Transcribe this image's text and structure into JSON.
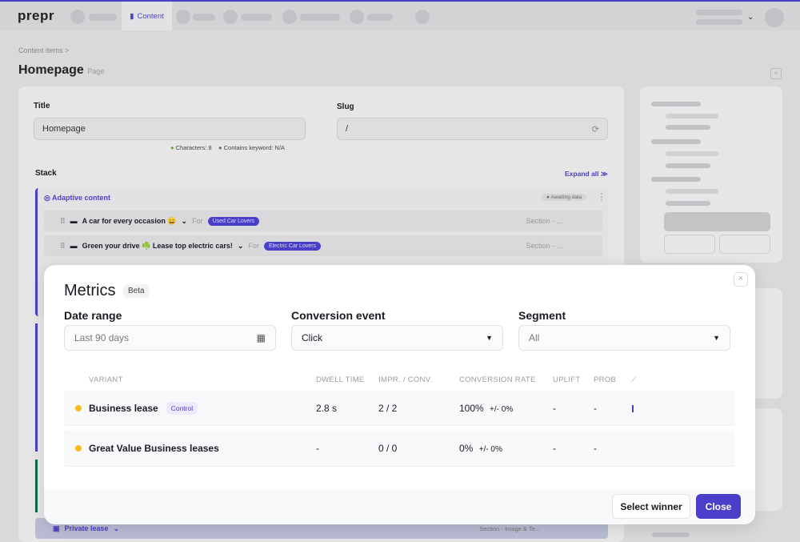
{
  "app": {
    "logo": "prepr",
    "active_tab": "Content"
  },
  "breadcrumb": {
    "item": "Content items",
    "separator": ">"
  },
  "page": {
    "title": "Homepage",
    "type": "Page"
  },
  "form": {
    "title_label": "Title",
    "title_value": "Homepage",
    "slug_label": "Slug",
    "slug_value": "/",
    "characters": "Characters: 8",
    "keyword": "Contains keyword: N/A",
    "stack_label": "Stack",
    "expand_all": "Expand all"
  },
  "stack": {
    "adaptive_label": "Adaptive content",
    "status": "Awaiting data",
    "rows": [
      {
        "title": "A car for every occasion 😀",
        "for": "For",
        "segment": "Used Car Lovers",
        "section": "Section - ..."
      },
      {
        "title": "Green your drive ☘️ Lease top electric cars!",
        "for": "For",
        "segment": "Electric Car Lovers",
        "section": "Section - ..."
      }
    ],
    "private": {
      "title": "Private lease",
      "section": "Section - Image & Te..."
    }
  },
  "modal": {
    "title": "Metrics",
    "badge": "Beta",
    "date_label": "Date range",
    "date_value": "Last 90 days",
    "event_label": "Conversion event",
    "event_value": "Click",
    "segment_label": "Segment",
    "segment_value": "All",
    "columns": [
      "VARIANT",
      "DWELL TIME",
      "IMPR. / CONV.",
      "CONVERSION RATE",
      "UPLIFT",
      "PROB"
    ],
    "rows": [
      {
        "variant": "Business lease",
        "badge": "Control",
        "dwell": "2.8 s",
        "impr": "2 / 2",
        "rate": "100%",
        "margin": "+/- 0%",
        "uplift": "-",
        "prob": "-"
      },
      {
        "variant": "Great Value Business leases",
        "dwell": "-",
        "impr": "0 / 0",
        "rate": "0%",
        "margin": "+/- 0%",
        "uplift": "-",
        "prob": "-"
      }
    ],
    "select_winner": "Select winner",
    "close": "Close",
    "colors": {
      "accent": "#4b3fc9",
      "variant_dot": "#f7bc1c"
    }
  }
}
